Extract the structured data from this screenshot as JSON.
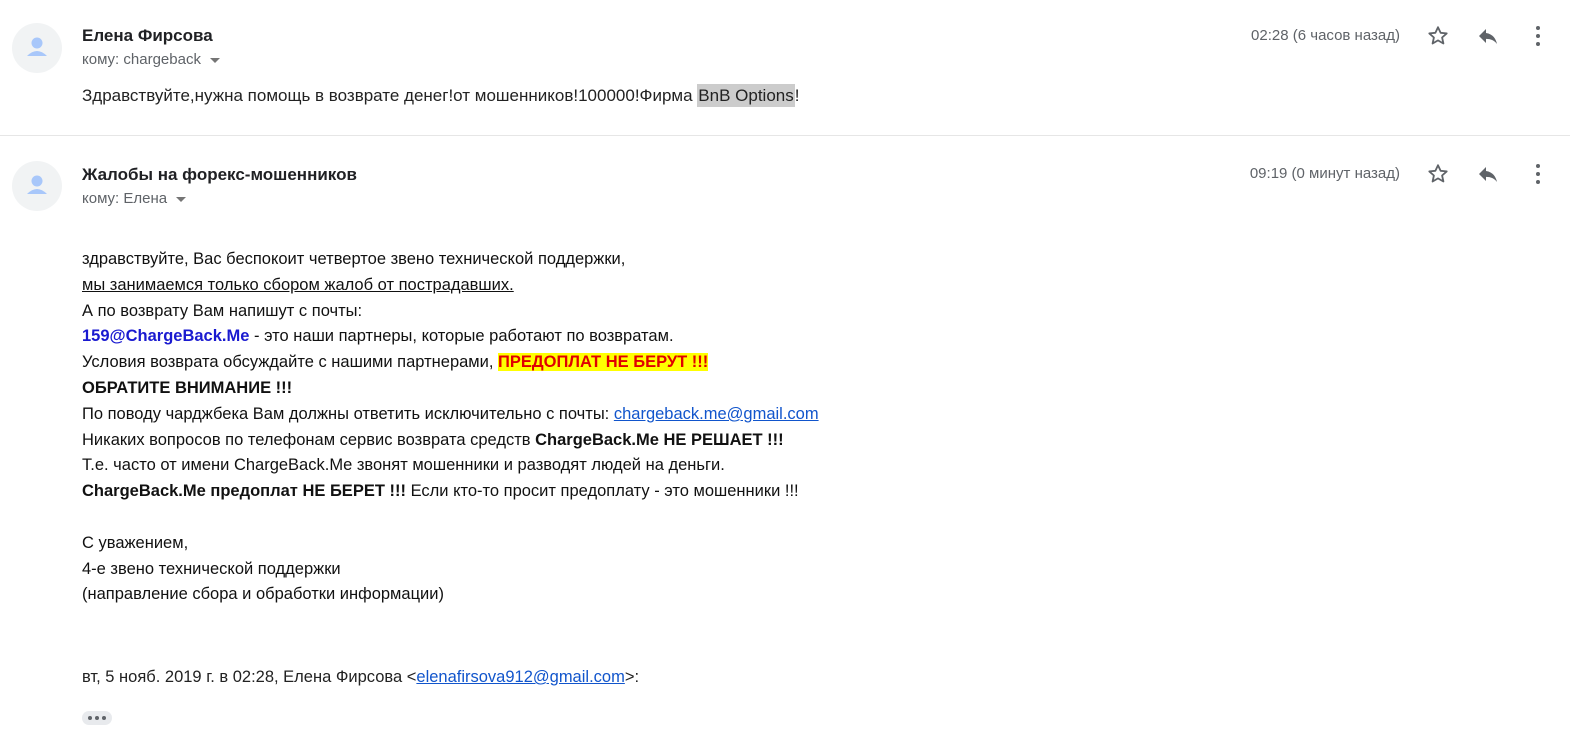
{
  "messages": [
    {
      "sender": "Елена Фирсова",
      "to": "кому: chargeback",
      "time": "02:28 (6 часов назад)",
      "snippet_prefix": "Здравствуйте,нужна помощь в возврате денег!от мошенников!100000!Фирма ",
      "snippet_highlight": "BnB Options",
      "snippet_suffix": "!"
    },
    {
      "sender": "Жалобы на форекс-мошенников",
      "to": "кому: Елена",
      "time": "09:19 (0 минут назад)",
      "body": {
        "l1": "здравствуйте, Вас беспокоит четвертое звено технической поддержки,",
        "l2": "мы занимаемся только сбором жалоб от пострадавших.",
        "l3": "А по возврату Вам напишут с почты:",
        "l4_email": "159@ChargeBack.Me",
        "l4_rest": " - это наши партнеры, которые работают по возвратам.",
        "l5_text": "Условия возврата обсуждайте с нашими партнерами, ",
        "l5_warn": "ПРЕДОПЛАТ НЕ БЕРУТ !!!",
        "l6": "ОБРАТИТЕ ВНИМАНИЕ !!!",
        "l7_text": "По поводу чарджбека Вам должны ответить исключительно с почты: ",
        "l7_link": "chargeback.me@gmail.com",
        "l8_text": "Никаких вопросов по телефонам сервис возврата средств ",
        "l8_bold": "ChargeBack.Me НЕ РЕШАЕТ !!!",
        "l9": "Т.е. часто от имени ChargeBack.Me звонят мошенники и разводят людей на деньги.",
        "l10_bold": "ChargeBack.Me предоплат НЕ БЕРЕТ !!!",
        "l10_text": " Если кто-то просит предоплату - это мошенники !!!",
        "sig1": "С уважением,",
        "sig2": "4-е звено технической поддержки",
        "sig3": "(направление сбора и обработки информации)"
      },
      "quote_prefix": "вт, 5 нояб. 2019 г. в 02:28, Елена Фирсова <",
      "quote_email": "elenafirsova912@gmail.com",
      "quote_suffix": ">:"
    }
  ],
  "icons": [
    "avatar-icon",
    "star-icon",
    "reply-icon",
    "more-vert-icon",
    "dropdown-caret-icon",
    "show-trimmed-content-icon"
  ],
  "colors": {
    "link": "#1155cc",
    "partner_email": "#1a1ad0",
    "warning_text": "#e00000",
    "warning_bg": "#ffff00",
    "snippet_highlight_bg": "#cccccc"
  }
}
